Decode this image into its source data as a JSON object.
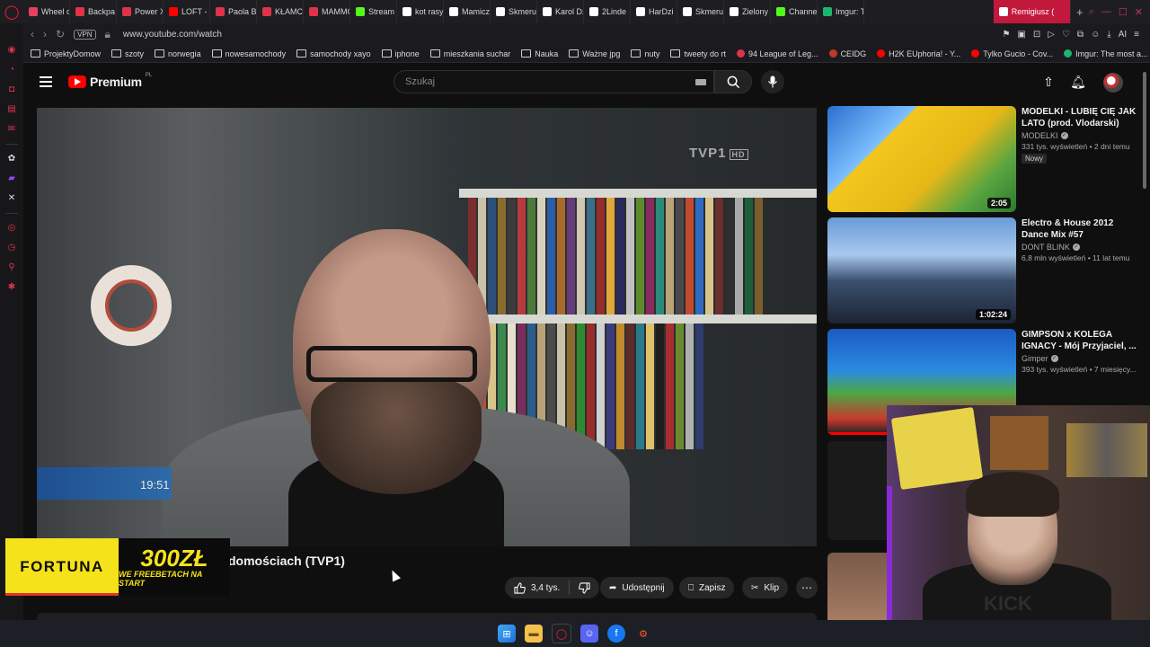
{
  "browser": {
    "tabs": [
      {
        "label": "Wheel o",
        "color": "#e4405f"
      },
      {
        "label": "Backpa",
        "color": "#e0334a"
      },
      {
        "label": "Power X",
        "color": "#e0334a"
      },
      {
        "label": "LOFT -",
        "color": "#ff0000"
      },
      {
        "label": "Paola Bl",
        "color": "#e0334a"
      },
      {
        "label": "KŁAMC",
        "color": "#e0334a"
      },
      {
        "label": "MAMMC",
        "color": "#e0334a"
      },
      {
        "label": "Stream",
        "color": "#53fc18"
      },
      {
        "label": "kot rasy",
        "color": "#ffffff"
      },
      {
        "label": "Mamicz",
        "color": "#ffffff"
      },
      {
        "label": "Skmeru",
        "color": "#ffffff"
      },
      {
        "label": "Karol Dz",
        "color": "#ffffff"
      },
      {
        "label": "2Linde",
        "color": "#ffffff"
      },
      {
        "label": "HarDzi",
        "color": "#ffffff"
      },
      {
        "label": "Skmeru",
        "color": "#ffffff"
      },
      {
        "label": "Zielony",
        "color": "#ffffff"
      },
      {
        "label": "Channel",
        "color": "#53fc18"
      },
      {
        "label": "Imgur: T",
        "color": "#1bb76e"
      }
    ],
    "active_tab": {
      "label": "Remigiusz (",
      "color": "#ff0000"
    },
    "new_tab": "+",
    "vpn": "VPN",
    "url": "www.youtube.com/watch"
  },
  "bookmarks": [
    {
      "label": "ProjektyDomow",
      "type": "folder"
    },
    {
      "label": "szoty",
      "type": "folder"
    },
    {
      "label": "norwegia",
      "type": "folder"
    },
    {
      "label": "nowesamochody",
      "type": "folder"
    },
    {
      "label": "samochody xayo",
      "type": "folder"
    },
    {
      "label": "iphone",
      "type": "folder"
    },
    {
      "label": "mieszkania suchar",
      "type": "folder"
    },
    {
      "label": "Nauka",
      "type": "folder"
    },
    {
      "label": "Ważne jpg",
      "type": "folder"
    },
    {
      "label": "nuty",
      "type": "folder"
    },
    {
      "label": "tweety do rt",
      "type": "folder"
    },
    {
      "label": "94 League of Leg...",
      "type": "site",
      "color": "#e0334a"
    },
    {
      "label": "CEIDG",
      "type": "site",
      "color": "#c0392b"
    },
    {
      "label": "H2K EUphoria! - Y...",
      "type": "site",
      "color": "#ff0000"
    },
    {
      "label": "Tylko Gucio - Cov...",
      "type": "site",
      "color": "#ff0000"
    },
    {
      "label": "Imgur: The most a...",
      "type": "site",
      "color": "#1bb76e"
    }
  ],
  "youtube": {
    "logo_text": "Premium",
    "logo_sup": "PL",
    "search_placeholder": "Szukaj"
  },
  "video": {
    "channel_watermark": "TVP1",
    "channel_watermark_hd": "HD",
    "overlay_time": "19:51",
    "title_visible": "domościach (TVP1)",
    "likes": "3,4 tys.",
    "share_label": "Udostępnij",
    "save_label": "Zapisz",
    "clip_label": "Klip"
  },
  "ad": {
    "brand": "FORTUNA",
    "amount": "300ZŁ",
    "tagline": "WE FREEBETACH NA START"
  },
  "recommendations": [
    {
      "title": "MODELKI - LUBIĘ CIĘ JAK LATO (prod. Vlodarski)",
      "channel": "MODELKI",
      "meta": "331 tys. wyświetleń • 2 dni temu",
      "badge": "Nowy",
      "duration": "2:05"
    },
    {
      "title": "Electro & House 2012 Dance Mix #57",
      "channel": "DONT BLINK",
      "meta": "6,8 mln wyświetleń • 11 lat temu",
      "duration": "1:02:24"
    },
    {
      "title": "GIMPSON x KOLEGA IGNACY - Mój Przyjaciel, ...",
      "channel": "Gimper",
      "meta": "393 tys. wyświetleń • 7 miesięcy..."
    }
  ],
  "webcam": {
    "sign_text": "KICK"
  }
}
